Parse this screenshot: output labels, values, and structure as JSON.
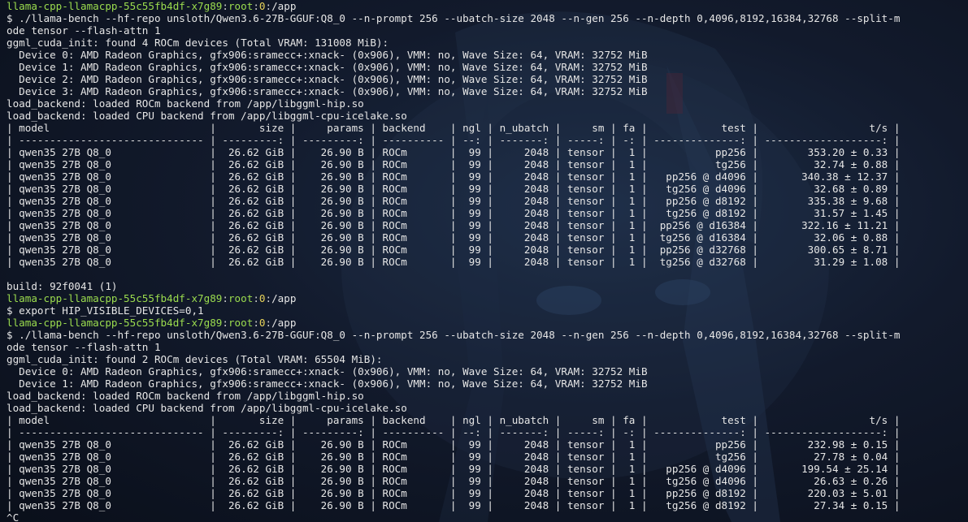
{
  "terminal": {
    "lines": [
      {
        "type": "prompt",
        "host": "llama-cpp-llamacpp-55c55fb4df-x7g89",
        "user": "root",
        "num": "0",
        "path": "/app"
      },
      {
        "type": "text",
        "text": "$ ./llama-bench --hf-repo unsloth/Qwen3.6-27B-GGUF:Q8_0 --n-prompt 256 --ubatch-size 2048 --n-gen 256 --n-depth 0,4096,8192,16384,32768 --split-m"
      },
      {
        "type": "text",
        "text": "ode tensor --flash-attn 1"
      },
      {
        "type": "text",
        "text": "ggml_cuda_init: found 4 ROCm devices (Total VRAM: 131008 MiB):"
      },
      {
        "type": "text",
        "text": "  Device 0: AMD Radeon Graphics, gfx906:sramecc+:xnack- (0x906), VMM: no, Wave Size: 64, VRAM: 32752 MiB"
      },
      {
        "type": "text",
        "text": "  Device 1: AMD Radeon Graphics, gfx906:sramecc+:xnack- (0x906), VMM: no, Wave Size: 64, VRAM: 32752 MiB"
      },
      {
        "type": "text",
        "text": "  Device 2: AMD Radeon Graphics, gfx906:sramecc+:xnack- (0x906), VMM: no, Wave Size: 64, VRAM: 32752 MiB"
      },
      {
        "type": "text",
        "text": "  Device 3: AMD Radeon Graphics, gfx906:sramecc+:xnack- (0x906), VMM: no, Wave Size: 64, VRAM: 32752 MiB"
      },
      {
        "type": "text",
        "text": "load_backend: loaded ROCm backend from /app/libggml-hip.so"
      },
      {
        "type": "text",
        "text": "load_backend: loaded CPU backend from /app/libggml-cpu-icelake.so"
      },
      {
        "type": "text",
        "text": "| model                          |       size |     params | backend    | ngl | n_ubatch |     sm | fa |            test |                  t/s |"
      },
      {
        "type": "text",
        "text": "| ------------------------------ | ---------: | ---------: | ---------- | --: | -------: | -----: | -: | --------------: | -------------------: |"
      },
      {
        "type": "text",
        "text": "| qwen35 27B Q8_0                |  26.62 GiB |    26.90 B | ROCm       |  99 |     2048 | tensor |  1 |           pp256 |        353.20 ± 0.33 |"
      },
      {
        "type": "text",
        "text": "| qwen35 27B Q8_0                |  26.62 GiB |    26.90 B | ROCm       |  99 |     2048 | tensor |  1 |           tg256 |         32.74 ± 0.88 |"
      },
      {
        "type": "text",
        "text": "| qwen35 27B Q8_0                |  26.62 GiB |    26.90 B | ROCm       |  99 |     2048 | tensor |  1 |   pp256 @ d4096 |       340.38 ± 12.37 |"
      },
      {
        "type": "text",
        "text": "| qwen35 27B Q8_0                |  26.62 GiB |    26.90 B | ROCm       |  99 |     2048 | tensor |  1 |   tg256 @ d4096 |         32.68 ± 0.89 |"
      },
      {
        "type": "text",
        "text": "| qwen35 27B Q8_0                |  26.62 GiB |    26.90 B | ROCm       |  99 |     2048 | tensor |  1 |   pp256 @ d8192 |        335.38 ± 9.68 |"
      },
      {
        "type": "text",
        "text": "| qwen35 27B Q8_0                |  26.62 GiB |    26.90 B | ROCm       |  99 |     2048 | tensor |  1 |   tg256 @ d8192 |         31.57 ± 1.45 |"
      },
      {
        "type": "text",
        "text": "| qwen35 27B Q8_0                |  26.62 GiB |    26.90 B | ROCm       |  99 |     2048 | tensor |  1 |  pp256 @ d16384 |       322.16 ± 11.21 |"
      },
      {
        "type": "text",
        "text": "| qwen35 27B Q8_0                |  26.62 GiB |    26.90 B | ROCm       |  99 |     2048 | tensor |  1 |  tg256 @ d16384 |         32.06 ± 0.88 |"
      },
      {
        "type": "text",
        "text": "| qwen35 27B Q8_0                |  26.62 GiB |    26.90 B | ROCm       |  99 |     2048 | tensor |  1 |  pp256 @ d32768 |        300.65 ± 8.71 |"
      },
      {
        "type": "text",
        "text": "| qwen35 27B Q8_0                |  26.62 GiB |    26.90 B | ROCm       |  99 |     2048 | tensor |  1 |  tg256 @ d32768 |         31.29 ± 1.08 |"
      },
      {
        "type": "text",
        "text": ""
      },
      {
        "type": "text",
        "text": "build: 92f0041 (1)"
      },
      {
        "type": "prompt",
        "host": "llama-cpp-llamacpp-55c55fb4df-x7g89",
        "user": "root",
        "num": "0",
        "path": "/app"
      },
      {
        "type": "text",
        "text": "$ export HIP_VISIBLE_DEVICES=0,1"
      },
      {
        "type": "prompt",
        "host": "llama-cpp-llamacpp-55c55fb4df-x7g89",
        "user": "root",
        "num": "0",
        "path": "/app"
      },
      {
        "type": "text",
        "text": "$ ./llama-bench --hf-repo unsloth/Qwen3.6-27B-GGUF:Q8_0 --n-prompt 256 --ubatch-size 2048 --n-gen 256 --n-depth 0,4096,8192,16384,32768 --split-m"
      },
      {
        "type": "text",
        "text": "ode tensor --flash-attn 1"
      },
      {
        "type": "text",
        "text": "ggml_cuda_init: found 2 ROCm devices (Total VRAM: 65504 MiB):"
      },
      {
        "type": "text",
        "text": "  Device 0: AMD Radeon Graphics, gfx906:sramecc+:xnack- (0x906), VMM: no, Wave Size: 64, VRAM: 32752 MiB"
      },
      {
        "type": "text",
        "text": "  Device 1: AMD Radeon Graphics, gfx906:sramecc+:xnack- (0x906), VMM: no, Wave Size: 64, VRAM: 32752 MiB"
      },
      {
        "type": "text",
        "text": "load_backend: loaded ROCm backend from /app/libggml-hip.so"
      },
      {
        "type": "text",
        "text": "load_backend: loaded CPU backend from /app/libggml-cpu-icelake.so"
      },
      {
        "type": "text",
        "text": "| model                          |       size |     params | backend    | ngl | n_ubatch |     sm | fa |            test |                  t/s |"
      },
      {
        "type": "text",
        "text": "| ------------------------------ | ---------: | ---------: | ---------- | --: | -------: | -----: | -: | --------------: | -------------------: |"
      },
      {
        "type": "text",
        "text": "| qwen35 27B Q8_0                |  26.62 GiB |    26.90 B | ROCm       |  99 |     2048 | tensor |  1 |           pp256 |        232.98 ± 0.15 |"
      },
      {
        "type": "text",
        "text": "| qwen35 27B Q8_0                |  26.62 GiB |    26.90 B | ROCm       |  99 |     2048 | tensor |  1 |           tg256 |         27.78 ± 0.04 |"
      },
      {
        "type": "text",
        "text": "| qwen35 27B Q8_0                |  26.62 GiB |    26.90 B | ROCm       |  99 |     2048 | tensor |  1 |   pp256 @ d4096 |       199.54 ± 25.14 |"
      },
      {
        "type": "text",
        "text": "| qwen35 27B Q8_0                |  26.62 GiB |    26.90 B | ROCm       |  99 |     2048 | tensor |  1 |   tg256 @ d4096 |         26.63 ± 0.26 |"
      },
      {
        "type": "text",
        "text": "| qwen35 27B Q8_0                |  26.62 GiB |    26.90 B | ROCm       |  99 |     2048 | tensor |  1 |   pp256 @ d8192 |        220.03 ± 5.01 |"
      },
      {
        "type": "text",
        "text": "| qwen35 27B Q8_0                |  26.62 GiB |    26.90 B | ROCm       |  99 |     2048 | tensor |  1 |   tg256 @ d8192 |         27.34 ± 0.15 |"
      },
      {
        "type": "text",
        "text": "^C"
      }
    ]
  },
  "colors": {
    "background": "#0d1220",
    "text": "#e6e6e6",
    "prompt_host": "#9bdc4e",
    "prompt_number": "#e8d35a"
  }
}
